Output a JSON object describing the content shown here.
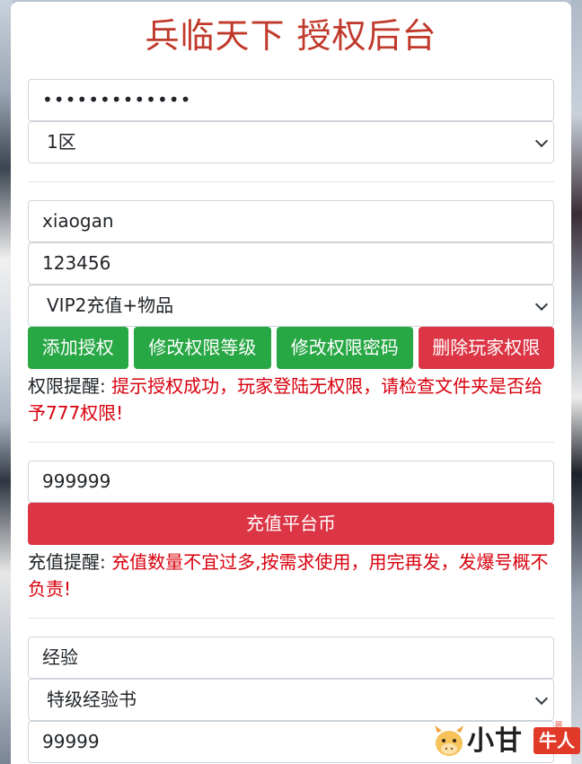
{
  "page": {
    "title": "兵临天下 授权后台"
  },
  "login": {
    "password_value": "•••••••••••••",
    "server_selected": "1区"
  },
  "player": {
    "account_value": "xiaogan",
    "password_value": "123456",
    "permission_selected": "VIP2充值+物品"
  },
  "actions": {
    "add_label": "添加授权",
    "modify_level_label": "修改权限等级",
    "modify_password_label": "修改权限密码",
    "delete_label": "删除玩家权限"
  },
  "permission_notice": {
    "prefix": "权限提醒: ",
    "message": "提示授权成功，玩家登陆无权限，请检查文件夹是否给予777权限!"
  },
  "recharge": {
    "amount_value": "999999",
    "button_label": "充值平台币"
  },
  "recharge_notice": {
    "prefix": "充值提醒: ",
    "message": "充值数量不宜过多,按需求使用，用完再发，发爆号概不负责!"
  },
  "items": {
    "type_value": "经验",
    "item_selected": "特级经验书",
    "quantity_value": "99999"
  },
  "watermark": {
    "text": "小甘",
    "tag": "牛人",
    "small": "网"
  },
  "colors": {
    "title": "#c0392b",
    "green_button": "#28a745",
    "red_button": "#dc3545",
    "notice_text": "#d9000d"
  }
}
